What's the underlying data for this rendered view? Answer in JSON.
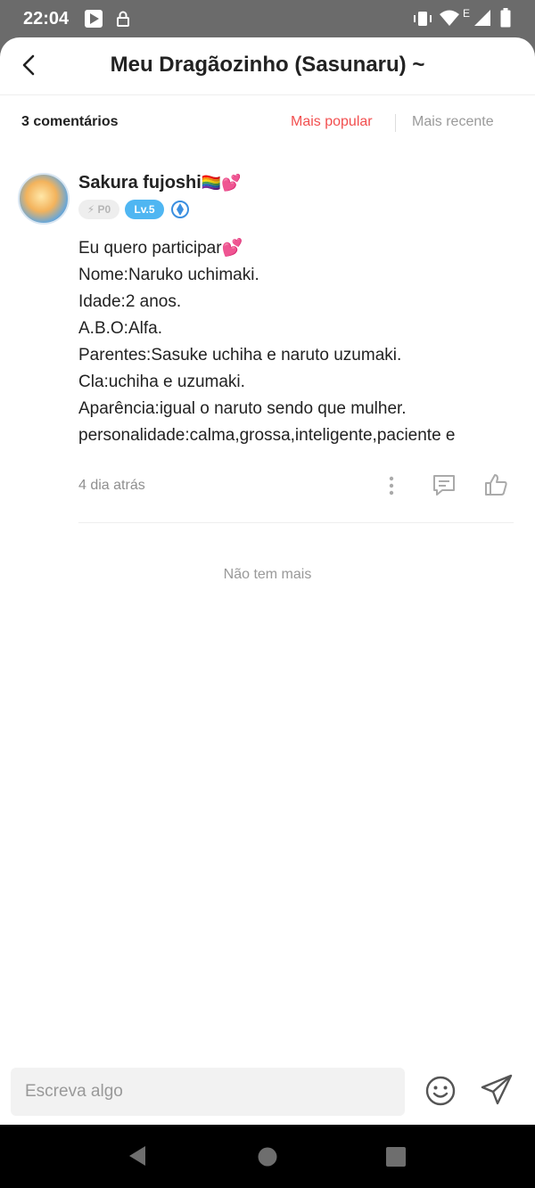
{
  "status_bar": {
    "time": "22:04",
    "network": "E"
  },
  "header": {
    "title": "Meu Dragãozinho (Sasunaru) ~"
  },
  "filters": {
    "count": "3 comentários",
    "popular": "Mais popular",
    "recent": "Mais recente",
    "active_color": "#f24f4f"
  },
  "comment": {
    "username": "Sakura fujoshi",
    "username_emoji": "🏳️‍🌈💕",
    "badge_points": "P0",
    "badge_level": "Lv.5",
    "lines": [
      "Eu quero participar💕",
      "Nome:Naruko uchimaki.",
      "Idade:2 anos.",
      "A.B.O:Alfa.",
      "Parentes:Sasuke uchiha e naruto uzumaki.",
      "Cla:uchiha e uzumaki.",
      "Aparência:igual o naruto sendo que mulher.",
      "personalidade:calma,grossa,inteligente,paciente e"
    ],
    "time": "4 dia atrás"
  },
  "footer_note": "Não tem mais",
  "composer": {
    "placeholder": "Escreva algo"
  }
}
